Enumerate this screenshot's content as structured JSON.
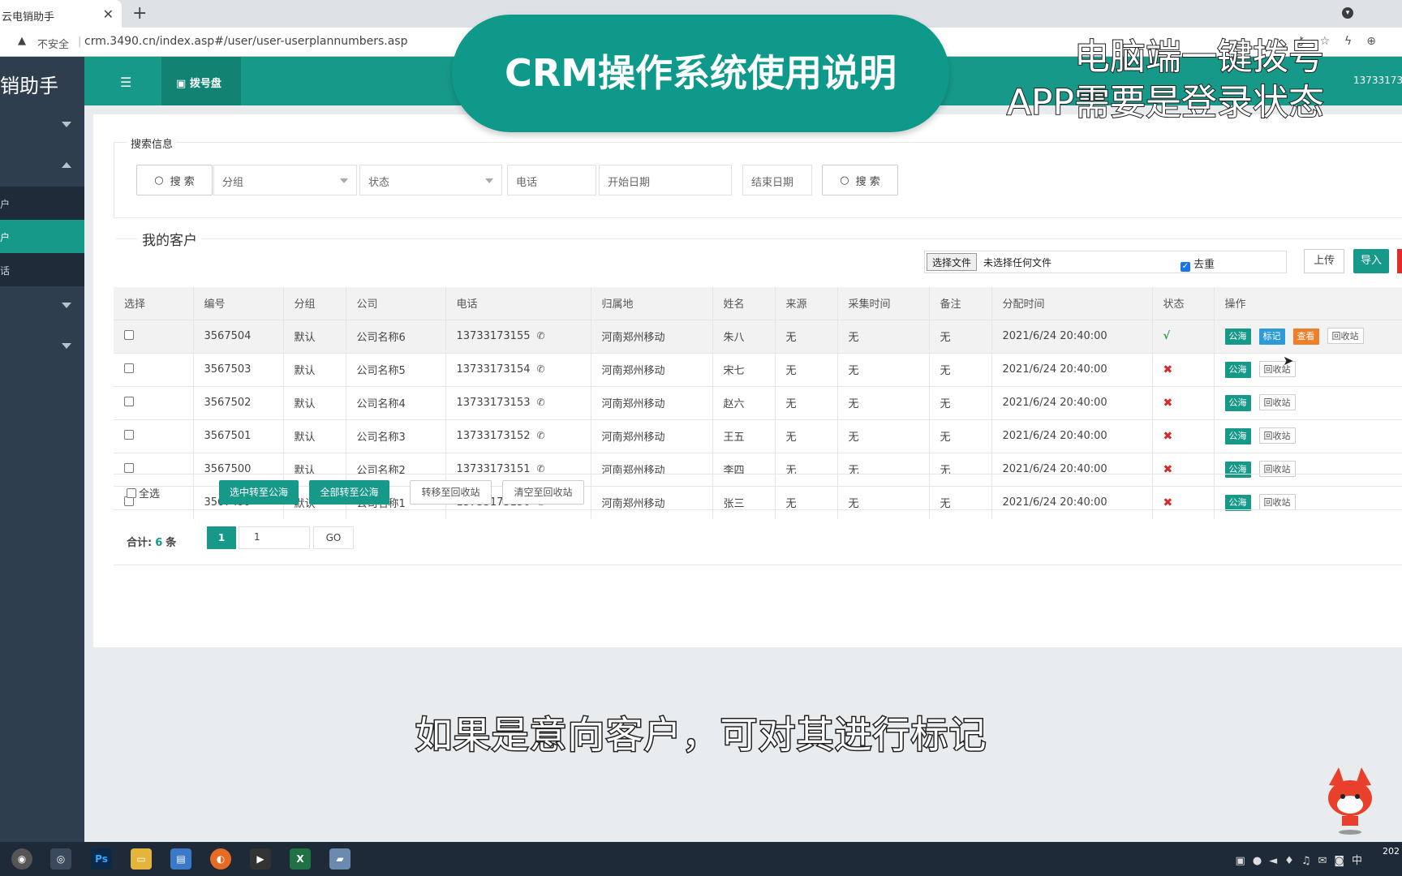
{
  "browser": {
    "tab_title": "云电销助手",
    "new_tab": "+",
    "security": "不安全",
    "url": "crm.3490.cn/index.asp#/user/user-userplannumbers.asp"
  },
  "sidebar": {
    "brand": "销助手",
    "items": [
      {
        "label": "户"
      },
      {
        "label": "户"
      },
      {
        "label": "话"
      }
    ]
  },
  "header": {
    "dial_tab": "拨号盘",
    "user": "13733173"
  },
  "search": {
    "legend": "搜索信息",
    "search_label": "搜 索",
    "group_placeholder": "分组",
    "status_placeholder": "状态",
    "phone_placeholder": "电话",
    "start_date_placeholder": "开始日期",
    "end_date_placeholder": "结束日期"
  },
  "customers": {
    "title": "我的客户",
    "file_button": "选择文件",
    "file_name": "未选择任何文件",
    "dedupe_label": "去重",
    "upload_label": "上传",
    "import_label": "导入"
  },
  "table": {
    "headers": [
      "选择",
      "编号",
      "分组",
      "公司",
      "电话",
      "归属地",
      "姓名",
      "来源",
      "采集时间",
      "备注",
      "分配时间",
      "状态",
      "操作"
    ],
    "rows": [
      {
        "id": "3567504",
        "group": "默认",
        "company": "公司名称6",
        "phone": "13733173155",
        "location": "河南郑州移动",
        "name": "朱八",
        "source": "无",
        "collect": "无",
        "note": "无",
        "assigned": "2021/6/24 20:40:00",
        "status": "√"
      },
      {
        "id": "3567503",
        "group": "默认",
        "company": "公司名称5",
        "phone": "13733173154",
        "location": "河南郑州移动",
        "name": "宋七",
        "source": "无",
        "collect": "无",
        "note": "无",
        "assigned": "2021/6/24 20:40:00",
        "status": "✖"
      },
      {
        "id": "3567502",
        "group": "默认",
        "company": "公司名称4",
        "phone": "13733173153",
        "location": "河南郑州移动",
        "name": "赵六",
        "source": "无",
        "collect": "无",
        "note": "无",
        "assigned": "2021/6/24 20:40:00",
        "status": "✖"
      },
      {
        "id": "3567501",
        "group": "默认",
        "company": "公司名称3",
        "phone": "13733173152",
        "location": "河南郑州移动",
        "name": "王五",
        "source": "无",
        "collect": "无",
        "note": "无",
        "assigned": "2021/6/24 20:40:00",
        "status": "✖"
      },
      {
        "id": "3567500",
        "group": "默认",
        "company": "公司名称2",
        "phone": "13733173151",
        "location": "河南郑州移动",
        "name": "李四",
        "source": "无",
        "collect": "无",
        "note": "无",
        "assigned": "2021/6/24 20:40:00",
        "status": "✖"
      },
      {
        "id": "3567499",
        "group": "默认",
        "company": "公司名称1",
        "phone": "13733173150",
        "location": "河南郑州移动",
        "name": "张三",
        "source": "无",
        "collect": "无",
        "note": "无",
        "assigned": "2021/6/24 20:40:00",
        "status": "✖"
      }
    ],
    "ops": {
      "sea": "公海",
      "mark": "标记",
      "view": "查看",
      "bin": "回收站"
    }
  },
  "bulk": {
    "select_all": "全选",
    "to_sea_selected": "选中转至公海",
    "to_sea_all": "全部转至公海",
    "to_bin": "转移至回收站",
    "clear_bin": "清空至回收站"
  },
  "pager": {
    "total_prefix": "合计:",
    "total_count": "6",
    "total_suffix": "条",
    "current_page": "1",
    "page_input": "1",
    "go": "GO"
  },
  "overlay": {
    "banner": "CRM操作系统使用说明",
    "caption_line1": "电脑端一键拨号",
    "caption_line2": "APP需要是登录状态",
    "subtitle": "如果是意向客户，可对其进行标记"
  },
  "taskbar": {
    "tray_lang": "中",
    "clock_year": "202"
  },
  "colors": {
    "primary": "#17998a",
    "sidebar": "#2f3e4e",
    "mark": "#2d9bd8",
    "view": "#f07f2a",
    "error": "#d52a2a"
  }
}
